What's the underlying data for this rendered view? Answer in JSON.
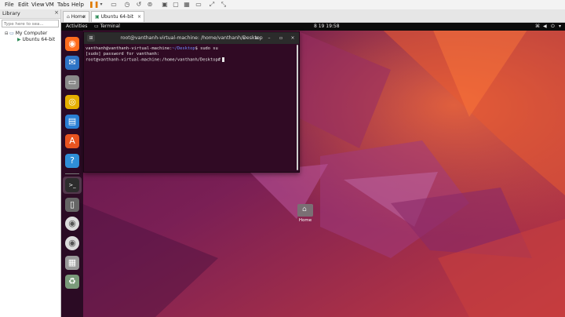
{
  "menubar": {
    "items": [
      "File",
      "Edit",
      "View",
      "VM",
      "Tabs",
      "Help"
    ],
    "toolbar_icons": [
      "pause-icon",
      "dropdown-icon",
      "send-keys-icon",
      "snapshot-icon",
      "revert-icon",
      "manage-snapshot-icon",
      "fullscreen-icon",
      "unity-icon",
      "console-icon",
      "stretch-icon",
      "scale-icon"
    ]
  },
  "library": {
    "title": "Library",
    "close": "×",
    "search_placeholder": "Type here to sea...",
    "tree": [
      {
        "label": "My Computer",
        "level": 0
      },
      {
        "label": "Ubuntu 64-bit",
        "level": 1
      }
    ]
  },
  "tabs": [
    {
      "label": "Home",
      "active": false
    },
    {
      "label": "Ubuntu 64-bit",
      "active": true
    }
  ],
  "guest": {
    "topbar": {
      "activities": "Activities",
      "app": "Terminal",
      "clock": "8 19  19:58"
    },
    "dock": [
      {
        "name": "firefox-icon",
        "color": "#ff6d1e",
        "glyph": "◉"
      },
      {
        "name": "thunderbird-icon",
        "color": "#2e74c6",
        "glyph": "✉"
      },
      {
        "name": "files-icon",
        "color": "#8a8a8a",
        "glyph": "▭"
      },
      {
        "name": "rhythmbox-icon",
        "color": "#e6b000",
        "glyph": "◎"
      },
      {
        "name": "writer-icon",
        "color": "#2a7fd4",
        "glyph": "▤"
      },
      {
        "name": "software-icon",
        "color": "#e95420",
        "glyph": "A"
      },
      {
        "name": "help-icon",
        "color": "#2f8fd8",
        "glyph": "?"
      },
      {
        "name": "terminal-icon",
        "color": "#2c2c2c",
        "glyph": ">_"
      },
      {
        "name": "drive-icon",
        "color": "#666666",
        "glyph": "▯"
      },
      {
        "name": "disc-icon-1",
        "color": "#dcdcdc",
        "glyph": "◉"
      },
      {
        "name": "disc-icon-2",
        "color": "#dcdcdc",
        "glyph": "◉"
      },
      {
        "name": "disk-icon",
        "color": "#9a9a9a",
        "glyph": "▦"
      },
      {
        "name": "trash-icon",
        "color": "#7a9a7a",
        "glyph": "♻"
      }
    ],
    "terminal": {
      "title": "root@vanthanh-virtual-machine: /home/vanthanh/Desktop",
      "line1_user": "vanthanh@vanthanh-virtual-machine:",
      "line1_path": "~/Desktop",
      "line1_cmd": "$ sudo su",
      "line2": "[sudo] password for vanthanh:",
      "line3": "root@vanthanh-virtual-machine:/home/vanthanh/Desktop#"
    },
    "desktop_icon_label": "Home"
  }
}
